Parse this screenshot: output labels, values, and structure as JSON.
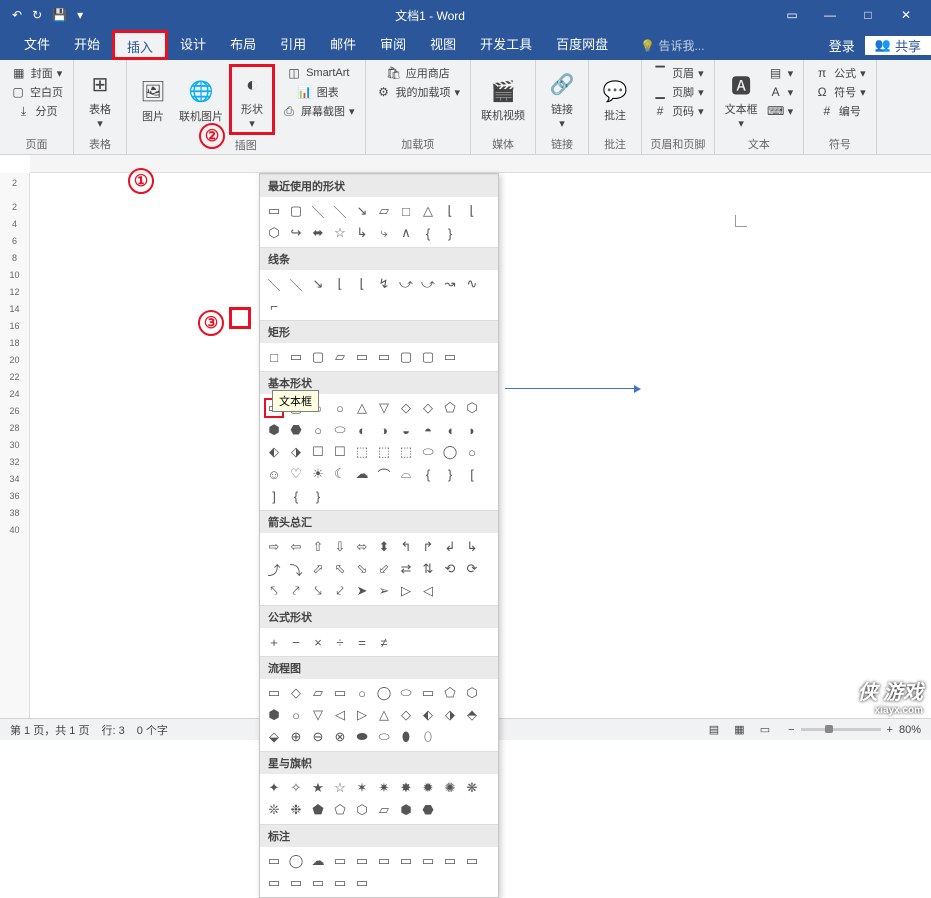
{
  "title": "文档1 - Word",
  "qat": {
    "undo": "↶",
    "redo": "↻",
    "save": "💾",
    "more": "▾"
  },
  "wincontrols": {
    "ribbonopts": "▭",
    "min": "—",
    "max": "□",
    "close": "✕"
  },
  "menu": {
    "file": "文件",
    "home": "开始",
    "insert": "插入",
    "design": "设计",
    "layout": "布局",
    "references": "引用",
    "mailings": "邮件",
    "review": "审阅",
    "view": "视图",
    "developer": "开发工具",
    "baidu": "百度网盘",
    "tellme": "告诉我...",
    "login": "登录",
    "share": "共享"
  },
  "ribbon": {
    "pages": {
      "cover": "封面",
      "blank": "空白页",
      "break": "分页",
      "label": "页面"
    },
    "tables": {
      "table": "表格",
      "label": "表格"
    },
    "illus": {
      "picture": "图片",
      "online": "联机图片",
      "shapes": "形状",
      "smartart": "SmartArt",
      "chart": "图表",
      "screenshot": "屏幕截图",
      "label": "插图"
    },
    "addins": {
      "store": "应用商店",
      "myaddins": "我的加载项",
      "label": "加载项"
    },
    "media": {
      "video": "联机视频",
      "label": "媒体"
    },
    "links": {
      "link": "链接",
      "label": "链接"
    },
    "comments": {
      "comment": "批注",
      "label": "批注"
    },
    "headerfooter": {
      "header": "页眉",
      "footer": "页脚",
      "pagenum": "页码",
      "label": "页眉和页脚"
    },
    "text": {
      "textbox": "文本框",
      "label": "文本"
    },
    "symbols": {
      "equation": "公式",
      "symbol": "符号",
      "number": "编号",
      "label": "符号"
    }
  },
  "shapes": {
    "recent": "最近使用的形状",
    "lines": "线条",
    "rects": "矩形",
    "basic": "基本形状",
    "arrows": "箭头总汇",
    "equation": "公式形状",
    "flowchart": "流程图",
    "stars": "星与旗帜",
    "callouts": "标注"
  },
  "tooltip": "文本框",
  "ruler_v": [
    "2",
    "",
    "2",
    "4",
    "6",
    "8",
    "10",
    "12",
    "14",
    "16",
    "18",
    "20",
    "22",
    "24",
    "26",
    "28",
    "30",
    "32",
    "34",
    "36",
    "38",
    "40"
  ],
  "status": {
    "page": "第 1 页，共 1 页",
    "line": "行: 3",
    "words": "0 个字",
    "zoom": "80%"
  },
  "callouts": {
    "c1": "①",
    "c2": "②",
    "c3": "③"
  },
  "watermark": {
    "main": "侠 游戏",
    "sub": "xiayx.com"
  }
}
